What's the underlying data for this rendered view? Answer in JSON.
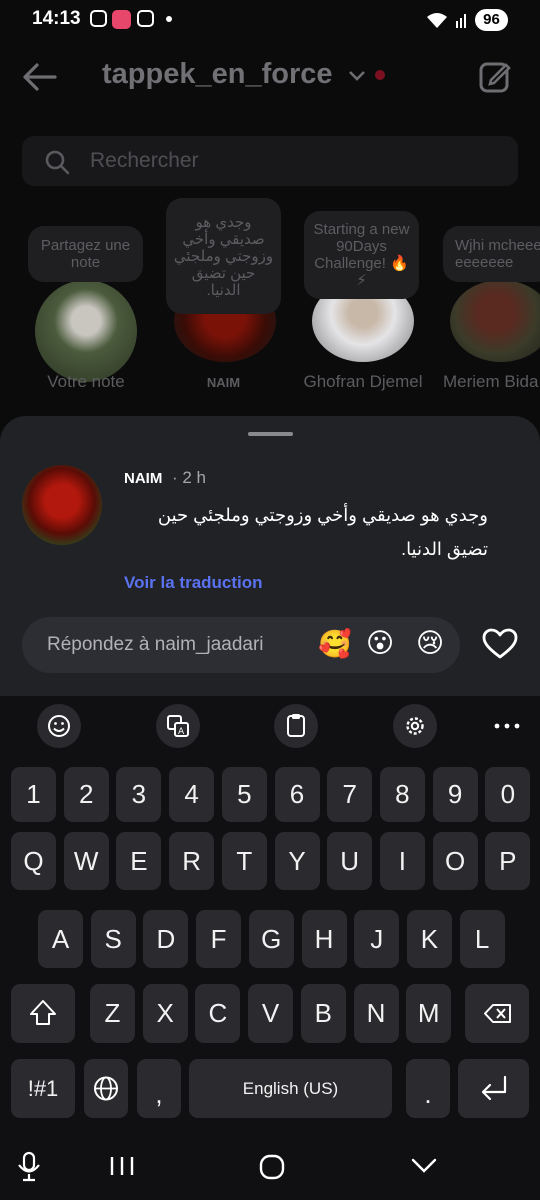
{
  "status_bar": {
    "time": "14:13",
    "battery": "96"
  },
  "header": {
    "title": "tappek_en_force"
  },
  "search": {
    "placeholder": "Rechercher"
  },
  "notes": [
    {
      "bubble": "Partagez une note",
      "name": "Votre note"
    },
    {
      "bubble": "وجدي هو صديقي وأخي وزوجتي وملجئي حين تضيق الدنيا.",
      "name": "NAIM"
    },
    {
      "bubble": "Starting a new 90Days Challenge! 🔥⚡",
      "name": "Ghofran Djemel"
    },
    {
      "bubble": "Wjhi mcheeeeeeeeee",
      "name": "Meriem Bida"
    }
  ],
  "sheet": {
    "author": "NAIM",
    "time": "· 2 h",
    "message": "وجدي هو صديقي وأخي وزوجتي وملجئي حين تضيق الدنيا.",
    "translate": "Voir la traduction",
    "reply_placeholder": "Répondez à naim_jaadari",
    "reactions": [
      "🥰",
      "😮",
      "😢"
    ]
  },
  "keyboard": {
    "row_numbers": [
      "1",
      "2",
      "3",
      "4",
      "5",
      "6",
      "7",
      "8",
      "9",
      "0"
    ],
    "row_q": [
      "Q",
      "W",
      "E",
      "R",
      "T",
      "Y",
      "U",
      "I",
      "O",
      "P"
    ],
    "row_a": [
      "A",
      "S",
      "D",
      "F",
      "G",
      "H",
      "J",
      "K",
      "L"
    ],
    "row_z": [
      "Z",
      "X",
      "C",
      "V",
      "B",
      "N",
      "M"
    ],
    "symbols": "!#1",
    "comma": ",",
    "space": "English (US)",
    "period": "."
  },
  "colors": {
    "background": "#0b0b0c",
    "sheet": "#212226",
    "key": "#2b2b2f",
    "link": "#5b72f0",
    "red_dot": "#7d1020"
  }
}
